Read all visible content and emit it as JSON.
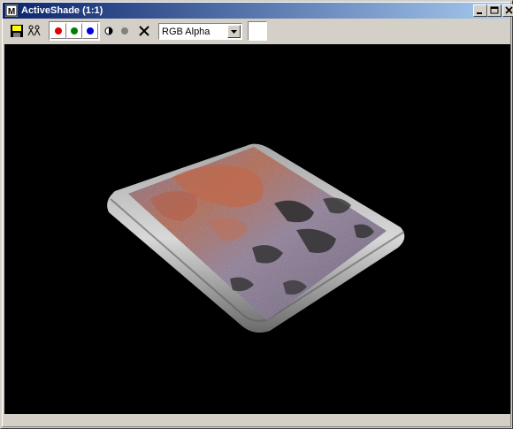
{
  "window": {
    "title": "ActiveShade (1:1)",
    "controls": [
      "minimize-icon",
      "maximize-icon",
      "close-icon"
    ]
  },
  "toolbar": {
    "tools": [
      "save-icon",
      "clone-icon"
    ],
    "channels": [
      {
        "name": "red-channel",
        "color": "#e00000"
      },
      {
        "name": "green-channel",
        "color": "#008000"
      },
      {
        "name": "blue-channel",
        "color": "#0000e0"
      }
    ],
    "alpha_icon": "alpha-channel-icon",
    "monochrome_icon": "monochrome-icon",
    "clear_icon": "clear-x-icon",
    "channel_display": "RGB Alpha",
    "swatch_color": "#ffffff"
  },
  "viewport": {
    "background": "#000000",
    "content": "rendered-rusty-metal-plate"
  }
}
